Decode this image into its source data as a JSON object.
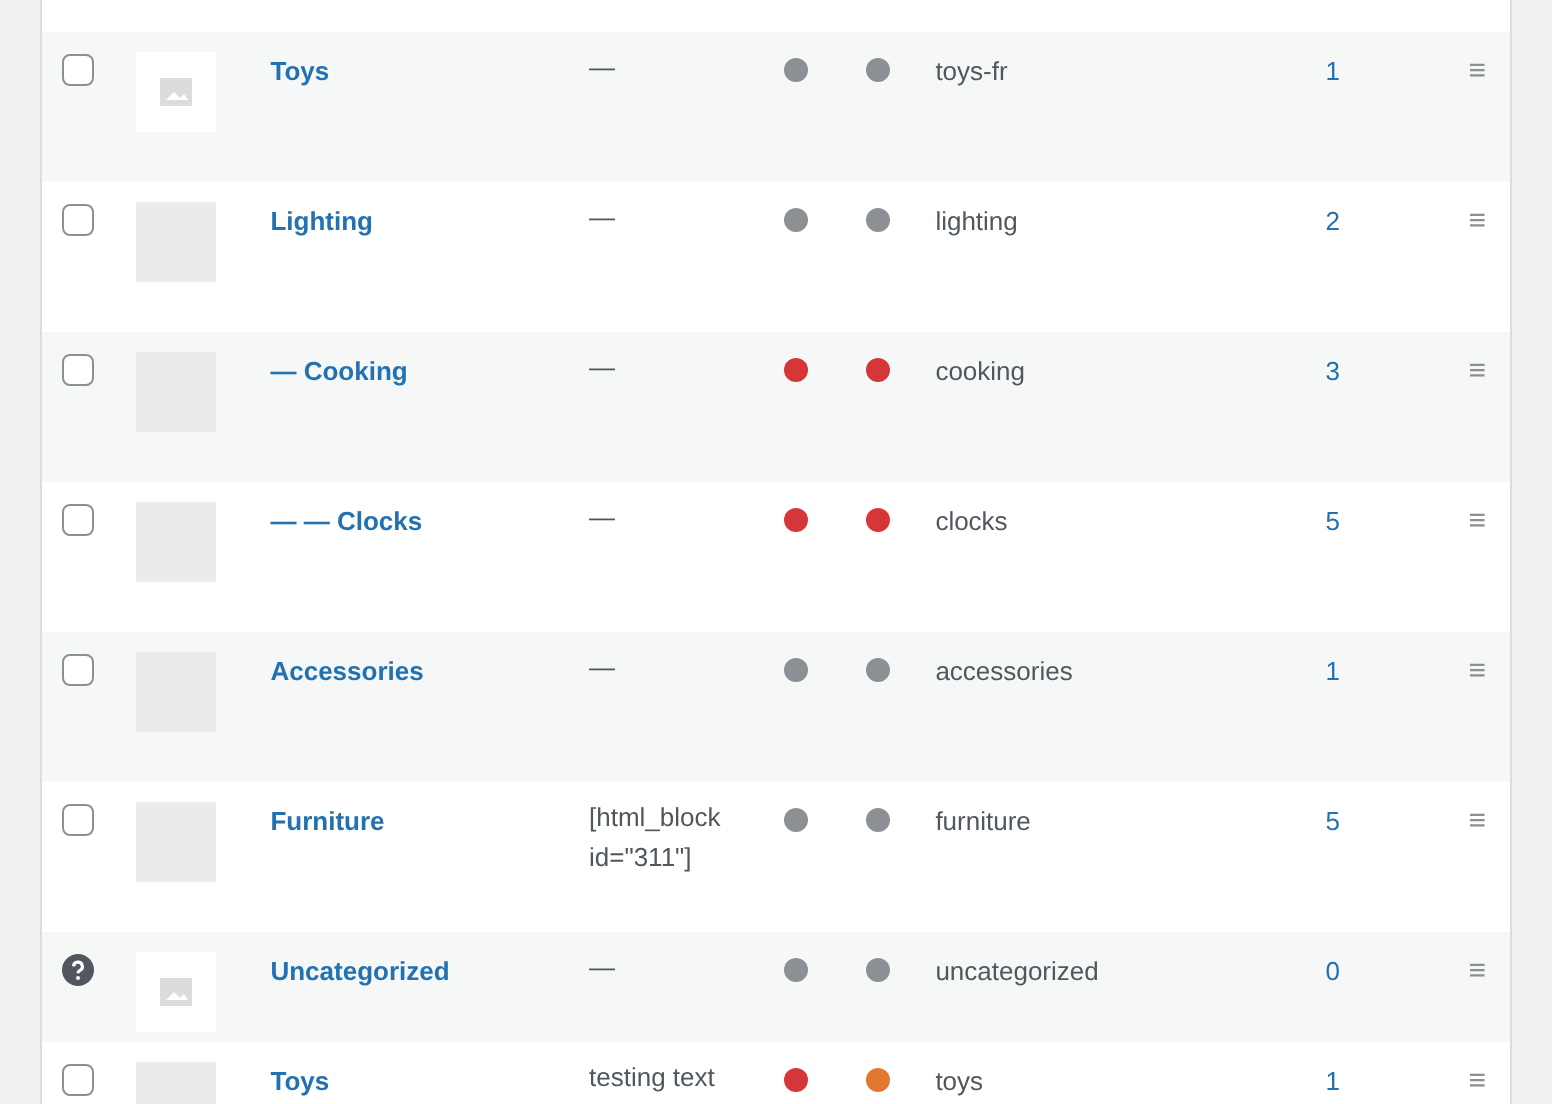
{
  "rows": [
    {
      "select": {
        "kind": "checkbox",
        "checked": false
      },
      "thumbnail": {
        "kind": "placeholder"
      },
      "name": "Toys",
      "description": "—",
      "dots": [
        {
          "color": "#8c8f94"
        },
        {
          "color": "#8c8f94"
        }
      ],
      "slug": "toys-fr",
      "count": "1",
      "handle": "≡"
    },
    {
      "select": {
        "kind": "checkbox",
        "checked": false
      },
      "thumbnail": {
        "kind": "blank"
      },
      "name": "Lighting",
      "description": "—",
      "dots": [
        {
          "color": "#8c8f94"
        },
        {
          "color": "#8c8f94"
        }
      ],
      "slug": "lighting",
      "count": "2",
      "handle": "≡"
    },
    {
      "select": {
        "kind": "checkbox",
        "checked": false
      },
      "thumbnail": {
        "kind": "blank"
      },
      "name": "— Cooking",
      "description": "—",
      "dots": [
        {
          "color": "#d63638"
        },
        {
          "color": "#d63638"
        }
      ],
      "slug": "cooking",
      "count": "3",
      "handle": "≡"
    },
    {
      "select": {
        "kind": "checkbox",
        "checked": false
      },
      "thumbnail": {
        "kind": "blank"
      },
      "name": "— — Clocks",
      "description": "—",
      "dots": [
        {
          "color": "#d63638"
        },
        {
          "color": "#d63638"
        }
      ],
      "slug": "clocks",
      "count": "5",
      "handle": "≡"
    },
    {
      "select": {
        "kind": "checkbox",
        "checked": false
      },
      "thumbnail": {
        "kind": "blank"
      },
      "name": "Accessories",
      "description": "—",
      "dots": [
        {
          "color": "#8c8f94"
        },
        {
          "color": "#8c8f94"
        }
      ],
      "slug": "accessories",
      "count": "1",
      "handle": "≡"
    },
    {
      "select": {
        "kind": "checkbox",
        "checked": false
      },
      "thumbnail": {
        "kind": "blank"
      },
      "name": "Furniture",
      "description": "[html_block id=\"311\"]",
      "dots": [
        {
          "color": "#8c8f94"
        },
        {
          "color": "#8c8f94"
        }
      ],
      "slug": "furniture",
      "count": "5",
      "handle": "≡"
    },
    {
      "select": {
        "kind": "help"
      },
      "thumbnail": {
        "kind": "placeholder"
      },
      "name": "Uncategorized",
      "description": "—",
      "dots": [
        {
          "color": "#8c8f94"
        },
        {
          "color": "#8c8f94"
        }
      ],
      "slug": "uncategorized",
      "count": "0",
      "handle": "≡"
    },
    {
      "select": {
        "kind": "checkbox",
        "checked": false
      },
      "thumbnail": {
        "kind": "blank"
      },
      "name": "Toys",
      "description": "testing text",
      "dots": [
        {
          "color": "#d63638"
        },
        {
          "color": "#e27730"
        }
      ],
      "slug": "toys",
      "count": "1",
      "handle": "≡"
    }
  ]
}
